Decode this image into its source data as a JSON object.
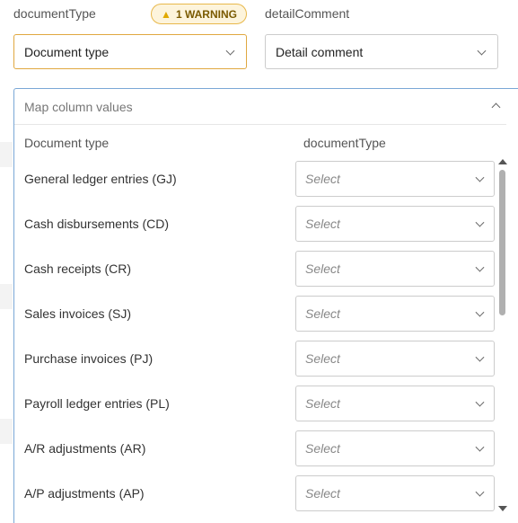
{
  "header": {
    "source_column": "documentType",
    "warning_badge": "1 WARNING",
    "detail_column": "detailComment"
  },
  "selects": {
    "document_type": "Document type",
    "detail_comment": "Detail comment"
  },
  "panel": {
    "title": "Map column values",
    "left_header": "Document type",
    "right_header": "documentType",
    "rows": [
      {
        "label": "General ledger entries (GJ)",
        "value": "Select"
      },
      {
        "label": "Cash disbursements (CD)",
        "value": "Select"
      },
      {
        "label": "Cash receipts (CR)",
        "value": "Select"
      },
      {
        "label": "Sales invoices (SJ)",
        "value": "Select"
      },
      {
        "label": "Purchase invoices (PJ)",
        "value": "Select"
      },
      {
        "label": "Payroll ledger entries (PL)",
        "value": "Select"
      },
      {
        "label": "A/R adjustments (AR)",
        "value": "Select"
      },
      {
        "label": "A/P adjustments (AP)",
        "value": "Select"
      }
    ]
  },
  "colors": {
    "warning_border": "#e0a840",
    "panel_border": "#7aa7d6"
  }
}
